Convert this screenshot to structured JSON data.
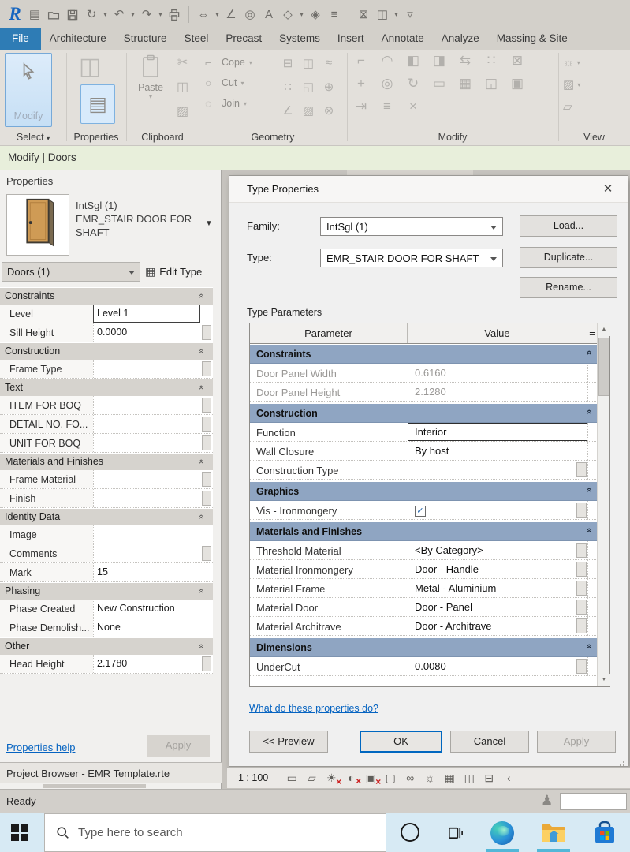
{
  "ui": {
    "collapse_glyph": "«",
    "caret_down": "▾",
    "check_glyph": "✓",
    "red_x": "×"
  },
  "qat": {
    "icons": [
      {
        "name": "revit-logo",
        "glyph": "R",
        "logo": true
      },
      {
        "name": "properties-window",
        "glyph": "▤"
      },
      {
        "name": "open-file",
        "svg": "folder"
      },
      {
        "name": "save",
        "svg": "floppy"
      },
      {
        "name": "sync-with-central",
        "glyph": "↻",
        "caret": true
      },
      {
        "name": "undo",
        "glyph": "↶",
        "caret": true
      },
      {
        "name": "redo",
        "glyph": "↷",
        "caret": true
      },
      {
        "name": "print",
        "svg": "printer"
      },
      {
        "name": "sep1",
        "sep": true
      },
      {
        "name": "measure",
        "glyph": "⇔",
        "caret": true
      },
      {
        "name": "aligned-dimension",
        "glyph": "∠"
      },
      {
        "name": "tag-by-category",
        "glyph": "◎"
      },
      {
        "name": "text",
        "glyph": "A"
      },
      {
        "name": "default-3d-view",
        "glyph": "◇",
        "caret": true
      },
      {
        "name": "section",
        "glyph": "◈"
      },
      {
        "name": "thin-lines",
        "glyph": "≡"
      },
      {
        "name": "sep2",
        "sep": true
      },
      {
        "name": "close-inactive-windows",
        "glyph": "⊠"
      },
      {
        "name": "switch-windows",
        "glyph": "◫",
        "caret": true
      },
      {
        "name": "customize-qat",
        "glyph": "▿"
      }
    ]
  },
  "tabs": {
    "file": "File",
    "items": [
      "Architecture",
      "Structure",
      "Steel",
      "Precast",
      "Systems",
      "Insert",
      "Annotate",
      "Analyze",
      "Massing & Site"
    ]
  },
  "ribbon": {
    "select": {
      "button": "Modify",
      "label": "Select"
    },
    "properties": {
      "label": "Properties"
    },
    "clipboard": {
      "label": "Clipboard",
      "paste": "Paste",
      "minis": [
        {
          "name": "cut-to-clipboard",
          "glyph": "✂"
        },
        {
          "name": "copy-to-clipboard",
          "glyph": "◫"
        },
        {
          "name": "match-type-properties",
          "glyph": "▨"
        }
      ]
    },
    "geometry": {
      "label": "Geometry",
      "rows": [
        {
          "name": "cope",
          "glyph": "⌐",
          "label": "Cope"
        },
        {
          "name": "cut",
          "glyph": "○",
          "label": "Cut"
        },
        {
          "name": "join",
          "glyph": "◌",
          "label": "Join"
        }
      ],
      "extras": [
        {
          "name": "beam-systems",
          "glyph": "⊟"
        },
        {
          "name": "wall-joins",
          "glyph": "◫"
        },
        {
          "name": "unjoin",
          "glyph": "≈"
        },
        {
          "name": "split-face",
          "glyph": "∷"
        },
        {
          "name": "paint",
          "glyph": "◱"
        },
        {
          "name": "add-point",
          "glyph": "⊕"
        },
        {
          "name": "demolish",
          "glyph": "∠"
        },
        {
          "name": "remove-paint",
          "glyph": "▨"
        },
        {
          "name": "split-element",
          "glyph": "⊗"
        }
      ]
    },
    "modify": {
      "label": "Modify",
      "rows": [
        [
          {
            "name": "align",
            "glyph": "⌐"
          },
          {
            "name": "fillet",
            "glyph": "◠"
          },
          {
            "name": "mirror-pick-axis",
            "glyph": "◧"
          },
          {
            "name": "mirror-draw-axis",
            "glyph": "◨"
          },
          {
            "name": "array",
            "glyph": "⇆"
          },
          {
            "name": "copy-multiple",
            "glyph": "∷"
          },
          {
            "name": "unpin",
            "glyph": "⊠"
          }
        ],
        [
          {
            "name": "move",
            "glyph": "+"
          },
          {
            "name": "copy",
            "glyph": "◎"
          },
          {
            "name": "rotate",
            "glyph": "↻"
          },
          {
            "name": "trim-extend",
            "glyph": "▭"
          },
          {
            "name": "scale-grid",
            "glyph": "▦"
          },
          {
            "name": "scale",
            "glyph": "◱"
          },
          {
            "name": "pin",
            "glyph": "▣"
          }
        ],
        [
          {
            "name": "offset",
            "glyph": "⇥"
          },
          {
            "name": "split",
            "glyph": "≡"
          },
          {
            "name": "delete",
            "glyph": "×"
          }
        ]
      ]
    },
    "view": {
      "label": "View",
      "items": [
        {
          "name": "reveal-hidden-elements",
          "glyph": "☼",
          "caret": true
        },
        {
          "name": "graphic-display-options",
          "glyph": "▨",
          "caret": true
        },
        {
          "name": "isolate",
          "glyph": "▱"
        }
      ]
    }
  },
  "context_bar": {
    "text": "Modify | Doors"
  },
  "properties_panel": {
    "title": "Properties",
    "type_name": "IntSgl (1)",
    "type_desc": "EMR_STAIR DOOR FOR SHAFT",
    "selector_value": "Doors (1)",
    "edit_type_label": "Edit Type",
    "groups": [
      {
        "name": "Constraints",
        "rows": [
          {
            "label": "Level",
            "value": "Level 1",
            "selected": true
          },
          {
            "label": "Sill Height",
            "value": "0.0000",
            "btn": true
          }
        ]
      },
      {
        "name": "Construction",
        "rows": [
          {
            "label": "Frame Type",
            "value": "",
            "btn": true
          }
        ]
      },
      {
        "name": "Text",
        "rows": [
          {
            "label": "ITEM FOR BOQ",
            "value": "",
            "btn": true
          },
          {
            "label": "DETAIL NO. FO...",
            "value": "",
            "btn": true
          },
          {
            "label": "UNIT FOR BOQ",
            "value": "",
            "btn": true
          }
        ]
      },
      {
        "name": "Materials and Finishes",
        "rows": [
          {
            "label": "Frame Material",
            "value": "",
            "btn": true
          },
          {
            "label": "Finish",
            "value": "",
            "btn": true
          }
        ]
      },
      {
        "name": "Identity Data",
        "rows": [
          {
            "label": "Image",
            "value": ""
          },
          {
            "label": "Comments",
            "value": "",
            "btn": true
          },
          {
            "label": "Mark",
            "value": "15"
          }
        ]
      },
      {
        "name": "Phasing",
        "rows": [
          {
            "label": "Phase Created",
            "value": "New Construction"
          },
          {
            "label": "Phase Demolish...",
            "value": "None"
          }
        ]
      },
      {
        "name": "Other",
        "rows": [
          {
            "label": "Head Height",
            "value": "2.1780",
            "btn": true
          }
        ]
      }
    ],
    "help_link": "Properties help",
    "apply_label": "Apply"
  },
  "dialog": {
    "title": "Type Properties",
    "family_label": "Family:",
    "family_value": "IntSgl (1)",
    "type_label": "Type:",
    "type_value": "EMR_STAIR DOOR FOR SHAFT",
    "load_label": "Load...",
    "duplicate_label": "Duplicate...",
    "rename_label": "Rename...",
    "table_title": "Type Parameters",
    "columns": {
      "parameter": "Parameter",
      "value": "Value",
      "eq": "="
    },
    "sections": [
      {
        "name": "Constraints",
        "rows": [
          {
            "param": "Door Panel Width",
            "value": "0.6160",
            "disabled": true
          },
          {
            "param": "Door Panel Height",
            "value": "2.1280",
            "disabled": true
          }
        ]
      },
      {
        "name": "Construction",
        "rows": [
          {
            "param": "Function",
            "value": "Interior",
            "selected": true
          },
          {
            "param": "Wall Closure",
            "value": "By host"
          },
          {
            "param": "Construction Type",
            "value": "",
            "btn": true
          }
        ]
      },
      {
        "name": "Graphics",
        "rows": [
          {
            "param": "Vis - Ironmongery",
            "value": "",
            "checkbox": true,
            "checked": true,
            "btn": true
          }
        ]
      },
      {
        "name": "Materials and Finishes",
        "rows": [
          {
            "param": "Threshold Material",
            "value": "<By Category>",
            "btn": true
          },
          {
            "param": "Material Ironmongery",
            "value": "Door - Handle",
            "btn": true
          },
          {
            "param": "Material Frame",
            "value": "Metal - Aluminium",
            "btn": true
          },
          {
            "param": "Material Door",
            "value": "Door - Panel",
            "btn": true
          },
          {
            "param": "Material Architrave",
            "value": "Door - Architrave",
            "btn": true
          }
        ]
      },
      {
        "name": "Dimensions",
        "rows": [
          {
            "param": "UnderCut",
            "value": "0.0080",
            "btn": true
          }
        ]
      }
    ],
    "help_link": "What do these properties do?",
    "preview_label": "<< Preview",
    "ok_label": "OK",
    "cancel_label": "Cancel",
    "apply_label": "Apply"
  },
  "view_bar": {
    "scale": "1 : 100",
    "icons": [
      {
        "name": "detail-level",
        "glyph": "▭"
      },
      {
        "name": "visual-style",
        "glyph": "▱"
      },
      {
        "name": "sun-path-off",
        "glyph": "☀",
        "x": true
      },
      {
        "name": "shadows-off",
        "glyph": "◐",
        "x": true
      },
      {
        "name": "crop-view-off",
        "glyph": "▣",
        "x": true
      },
      {
        "name": "show-crop-region",
        "glyph": "▢"
      },
      {
        "name": "temporary-hide-isolate",
        "glyph": "∞"
      },
      {
        "name": "reveal-hidden-elements",
        "glyph": "☼"
      },
      {
        "name": "temporary-view-properties",
        "glyph": "▦"
      },
      {
        "name": "analytical-model",
        "glyph": "◫"
      },
      {
        "name": "reveal-constraints",
        "glyph": "⊟"
      },
      {
        "name": "collapse-bar",
        "glyph": "‹"
      }
    ]
  },
  "project_browser": {
    "text": "Project Browser - EMR Template.rte"
  },
  "status": {
    "text": "Ready"
  },
  "taskbar": {
    "search_placeholder": "Type here to search"
  }
}
